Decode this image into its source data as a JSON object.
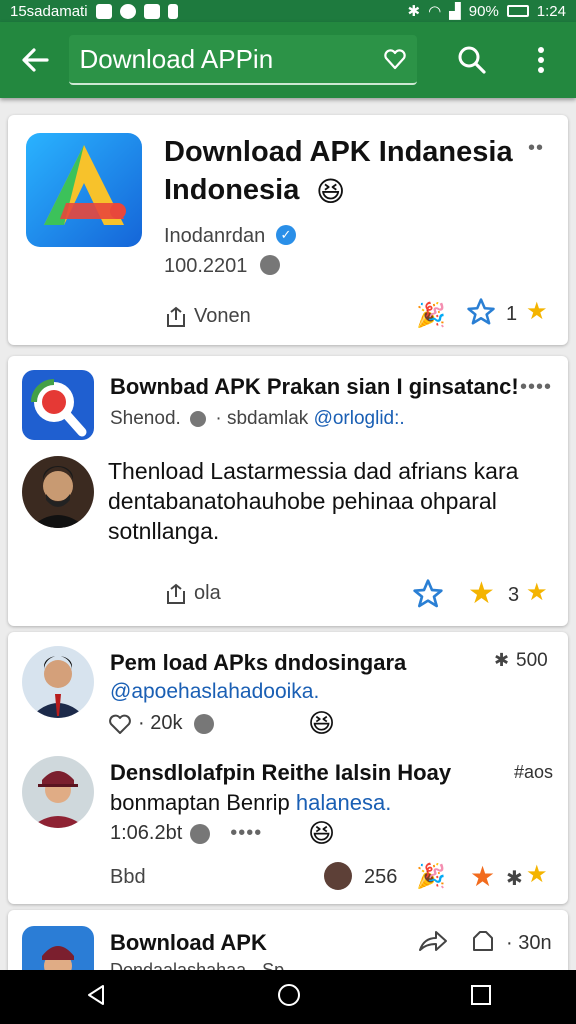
{
  "status_bar": {
    "left_text": "15sadamati",
    "battery": "90%",
    "time": "1:24"
  },
  "app_bar": {
    "search_value": "Download APPin",
    "icons": [
      "back-arrow-icon",
      "heart-outline-icon",
      "search-icon",
      "more-vert-icon"
    ]
  },
  "card1": {
    "title_line1": "Download APK Indanesia",
    "title_line2": "Indonesia",
    "emoji": "😆",
    "publisher": "Inodanrdan",
    "number": "100.2201",
    "action_label": "Vonen",
    "like_count": "1"
  },
  "card2": {
    "title": "Bownbad APK Prakan sian I ginsatanc!",
    "meta_prefix": "Shenod.",
    "meta_mid": "· sbdamlak",
    "meta_handle": "@orloglid:.",
    "body": "Thenload Lastarmessia dad afrians kara dentabanatohauhobe pehinaa ohparal sotnllanga.",
    "share_label": "ola",
    "count": "3"
  },
  "card3": {
    "item1": {
      "title": "Pem load APks dndosingara",
      "handle": "@apoehaslahadooika.",
      "likes": "· 20k",
      "side_count": "500"
    },
    "item2": {
      "title": "Densdlolafpin Reithe Ialsin Hoay",
      "body_prefix": "bonmaptan Benrip",
      "body_handle": "halanesa.",
      "time": "1:06.2bt",
      "dots": "••••",
      "side_count": "#aos"
    },
    "footer_label": "Bbd",
    "footer_count": "256"
  },
  "card4": {
    "title": "Bownload APK",
    "subtitle": "Dondaalashahaa - Sp",
    "count": "· 30n"
  }
}
